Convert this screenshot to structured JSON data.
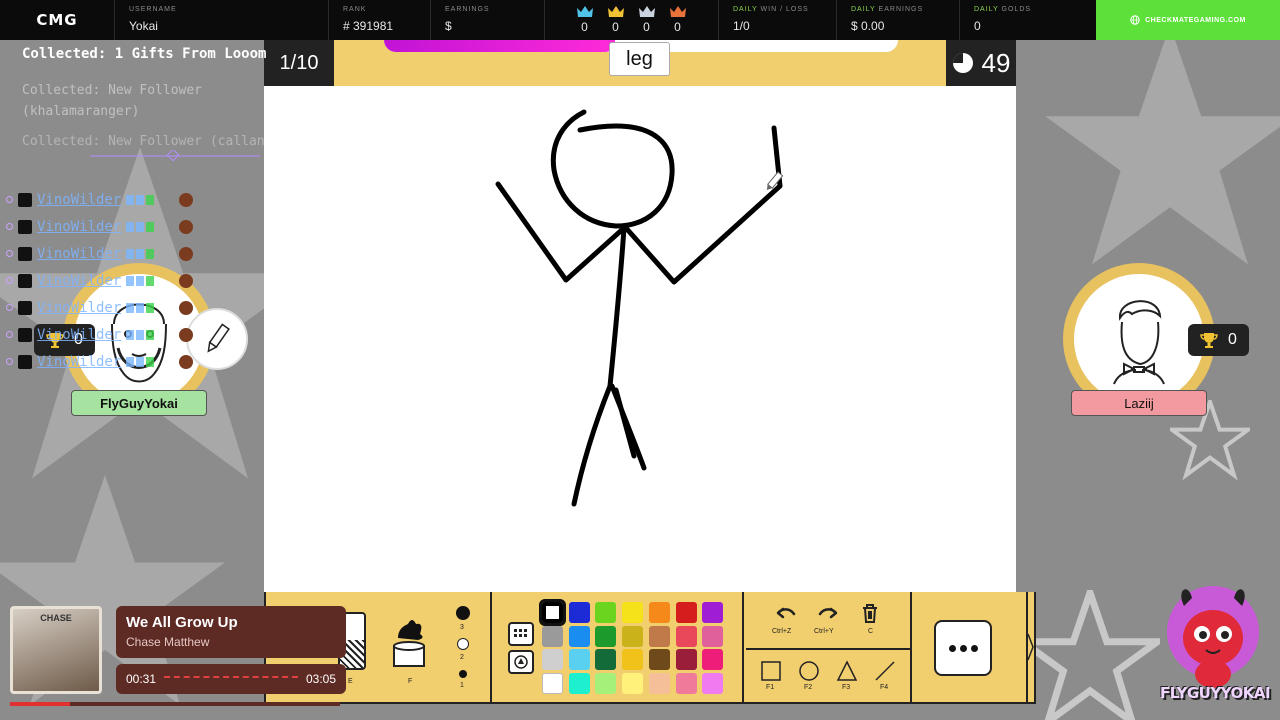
{
  "topbar": {
    "logo": "CMG",
    "username_label": "USERNAME",
    "username": "Yokai",
    "rank_label": "RANK",
    "rank": "# 391981",
    "earnings_label": "EARNINGS",
    "earnings": "$",
    "crowns": [
      {
        "color": "#4fc4e8",
        "value": "0"
      },
      {
        "color": "#f1c232",
        "value": "0"
      },
      {
        "color": "#c9d3e0",
        "value": "0"
      },
      {
        "color": "#e8733a",
        "value": "0"
      }
    ],
    "daily_wl_label_hl": "DAILY",
    "daily_wl_label": "WIN / LOSS",
    "daily_wl": "1/0",
    "daily_earn_label_hl": "DAILY",
    "daily_earn_label": "EARNINGS",
    "daily_earnings": "$ 0.00",
    "daily_golds_label_hl": "DAILY",
    "daily_golds_label": "GOLDS",
    "daily_golds": "0",
    "site_button": "CHECKMATEGAMING.COM"
  },
  "game": {
    "round": "1/10",
    "word": "leg",
    "timer": "49",
    "progress": 0.45
  },
  "players": {
    "left": {
      "name": "FlyGuyYokai",
      "score": "0"
    },
    "right": {
      "name": "Laziij",
      "score": "0"
    }
  },
  "overlay": {
    "collected_main": "Collected: 1 Gifts From Looom",
    "collected_second": "Collected: New Follower (khalamaranger)",
    "collected_third": "Collected: New Follower (callan15)",
    "chat_name": "VinoWilder",
    "chat_rows": 7
  },
  "toolbar": {
    "eraser_key": "E",
    "fill_key": "F",
    "sizes": [
      "3",
      "2",
      "1"
    ],
    "palette": [
      "#000000",
      "#1d2bd6",
      "#6ad41f",
      "#f5e21b",
      "#f58a1b",
      "#d61d1d",
      "#a01dd6",
      "#9a9a9a",
      "#1a8ef0",
      "#1c9a2c",
      "#c9b21a",
      "#c07a4a",
      "#e8485a",
      "#e0609c",
      "#cfcfcf",
      "#5ad0f0",
      "#136b3a",
      "#f0c21a",
      "#6e4a1a",
      "#9a1d3a",
      "#ee1d7a",
      "#ffffff",
      "#1ef0cf",
      "#a5f07a",
      "#fff17a",
      "#f5bf9a",
      "#f07a9a",
      "#f07af0"
    ],
    "undo_key": "Ctrl+Z",
    "redo_key": "Ctrl+Y",
    "clear_key": "C",
    "shape_keys": [
      "F1",
      "F2",
      "F3",
      "F4"
    ]
  },
  "music": {
    "title": "We All Grow Up",
    "artist": "Chase Matthew",
    "elapsed": "00:31",
    "total": "03:05",
    "art_text": "CHASE"
  },
  "mascot": {
    "name": "FLYGUYYOKAI"
  }
}
